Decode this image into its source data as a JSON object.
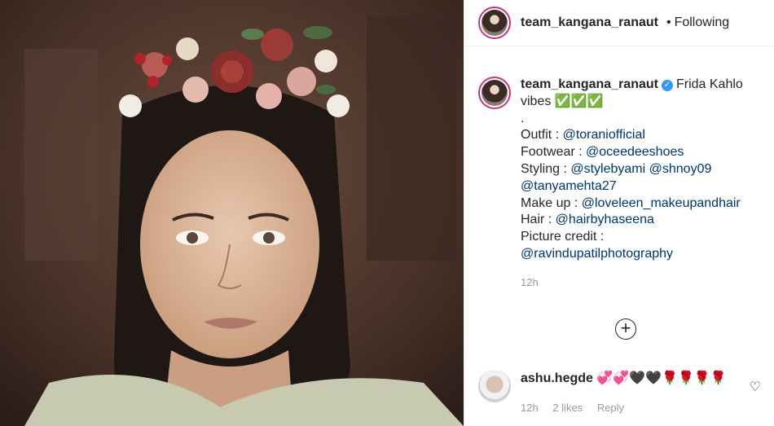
{
  "header": {
    "username": "team_kangana_ranaut",
    "dot": "•",
    "follow_status": "Following"
  },
  "caption": {
    "username": "team_kangana_ranaut",
    "verified_icon": "✓",
    "lines": {
      "l1_text": "Frida Kahlo",
      "l2_text": "vibes ✅✅✅",
      "l3_text": ".",
      "outfit_label": "Outfit : ",
      "outfit_mention": "@toraniofficial",
      "footwear_label": "Footwear : ",
      "footwear_mention": "@oceedeeshoes",
      "styling_label": "Styling : ",
      "styling_mention1": "@stylebyami",
      "styling_mention2": "@shnoy09",
      "styling_mention3": "@tanyamehta27",
      "makeup_label": "Make up : ",
      "makeup_mention": "@loveleen_makeupandhair",
      "hair_label": "Hair : ",
      "hair_mention": "@hairbyhaseena",
      "credit_label": "Picture credit :",
      "credit_mention": "@ravindupatilphotography"
    },
    "time": "12h"
  },
  "load_more_icon": "+",
  "comment": {
    "username": "ashu.hegde",
    "text": "💞💞🖤🖤🌹🌹🌹🌹",
    "time": "12h",
    "likes": "2 likes",
    "reply": "Reply",
    "heart_icon": "♡"
  }
}
